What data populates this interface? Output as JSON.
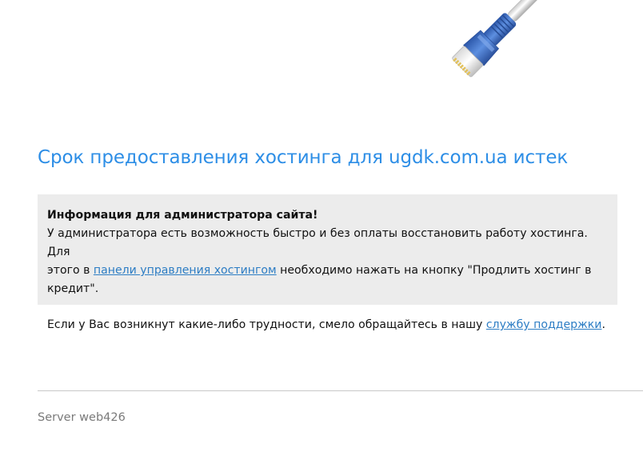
{
  "title": "Срок предоставления хостинга для ugdk.com.ua истек",
  "info": {
    "heading": "Информация для администратора сайта!",
    "line1": "У администратора есть возможность быстро и без оплаты восстановить работу хостинга. Для",
    "line2_before": "этого в ",
    "line2_link": "панели управления хостингом",
    "line2_after": " необходимо нажать на кнопку \"Продлить хостинг в кредит\".",
    "line3_before": "Если у Вас возникнут какие-либо трудности, смело обращайтесь в нашу ",
    "line3_link": "службу поддержки",
    "line3_after": "."
  },
  "footer": {
    "server": "Server web426"
  },
  "icons": {
    "cable": "network-cable-icon"
  },
  "colors": {
    "title": "#2d8ee6",
    "link": "#2d7dc4",
    "box_bg": "#ececec",
    "footer_text": "#7a7a7a",
    "cable_blue": "#3a6fc9"
  }
}
